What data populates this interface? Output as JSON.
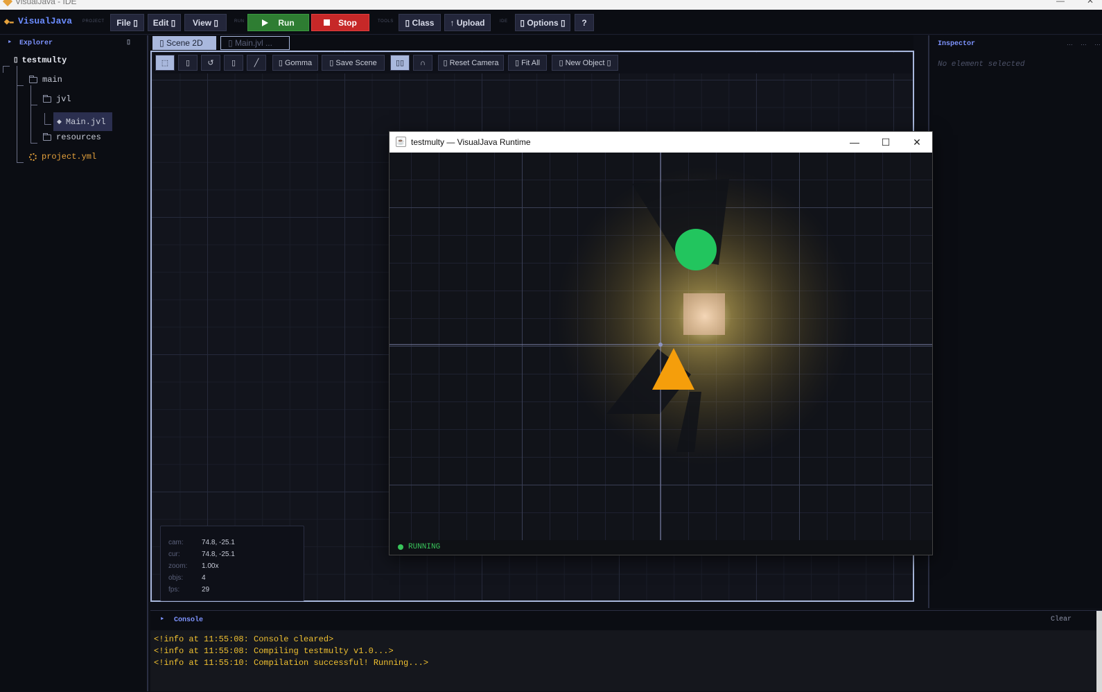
{
  "window": {
    "title": "VisualJava - IDE"
  },
  "toolbar": {
    "brand": "VisualJava",
    "groups": {
      "project": "PROJECT",
      "run": "RUN",
      "tools": "TOOLS",
      "ide": "IDE"
    },
    "file": "File ▯",
    "edit": "Edit ▯",
    "view": "View ▯",
    "run": "Run",
    "stop": "Stop",
    "class": "▯ Class",
    "upload": "↑ Upload",
    "options": "▯ Options ▯",
    "help": "?"
  },
  "explorer": {
    "title": "Explorer",
    "tree": {
      "root": "testmulty",
      "main": "main",
      "jvl": "jvl",
      "main_file": "Main.jvl",
      "resources": "resources",
      "project_file": "project.yml"
    }
  },
  "editor": {
    "tabs": [
      {
        "label": "▯ Scene 2D"
      },
      {
        "label": "▯ Main.jvl  ..."
      }
    ],
    "scene_toolbar": {
      "gomma": "▯ Gomma",
      "save_scene": "▯ Save Scene",
      "reset_camera": "▯ Reset Camera",
      "fit_all": "▯ Fit All",
      "new_object": "▯ New Object ▯"
    },
    "hud": {
      "cam_label": "cam:",
      "cam": "74.8, -25.1",
      "cur_label": "cur:",
      "cur": "74.8, -25.1",
      "zoom_label": "zoom:",
      "zoom": "1.00x",
      "objs_label": "objs:",
      "objs": "4",
      "fps_label": "fps:",
      "fps": "29"
    }
  },
  "runtime": {
    "title": "testmulty — VisualJava Runtime",
    "status": "RUNNING",
    "colors": {
      "circle": "#22c55e",
      "triangle": "#f59e0b",
      "light_square": "#f4c7b0",
      "glow": "#d9b84a"
    }
  },
  "inspector": {
    "title": "Inspector",
    "empty_text": "No element selected"
  },
  "console": {
    "title": "Console",
    "clear": "Clear",
    "lines": [
      "<!info at 11:55:08: Console cleared>",
      "<!info at 11:55:08: Compiling testmulty v1.0...>",
      "<!info at 11:55:10: Compilation successful! Running...>"
    ]
  }
}
